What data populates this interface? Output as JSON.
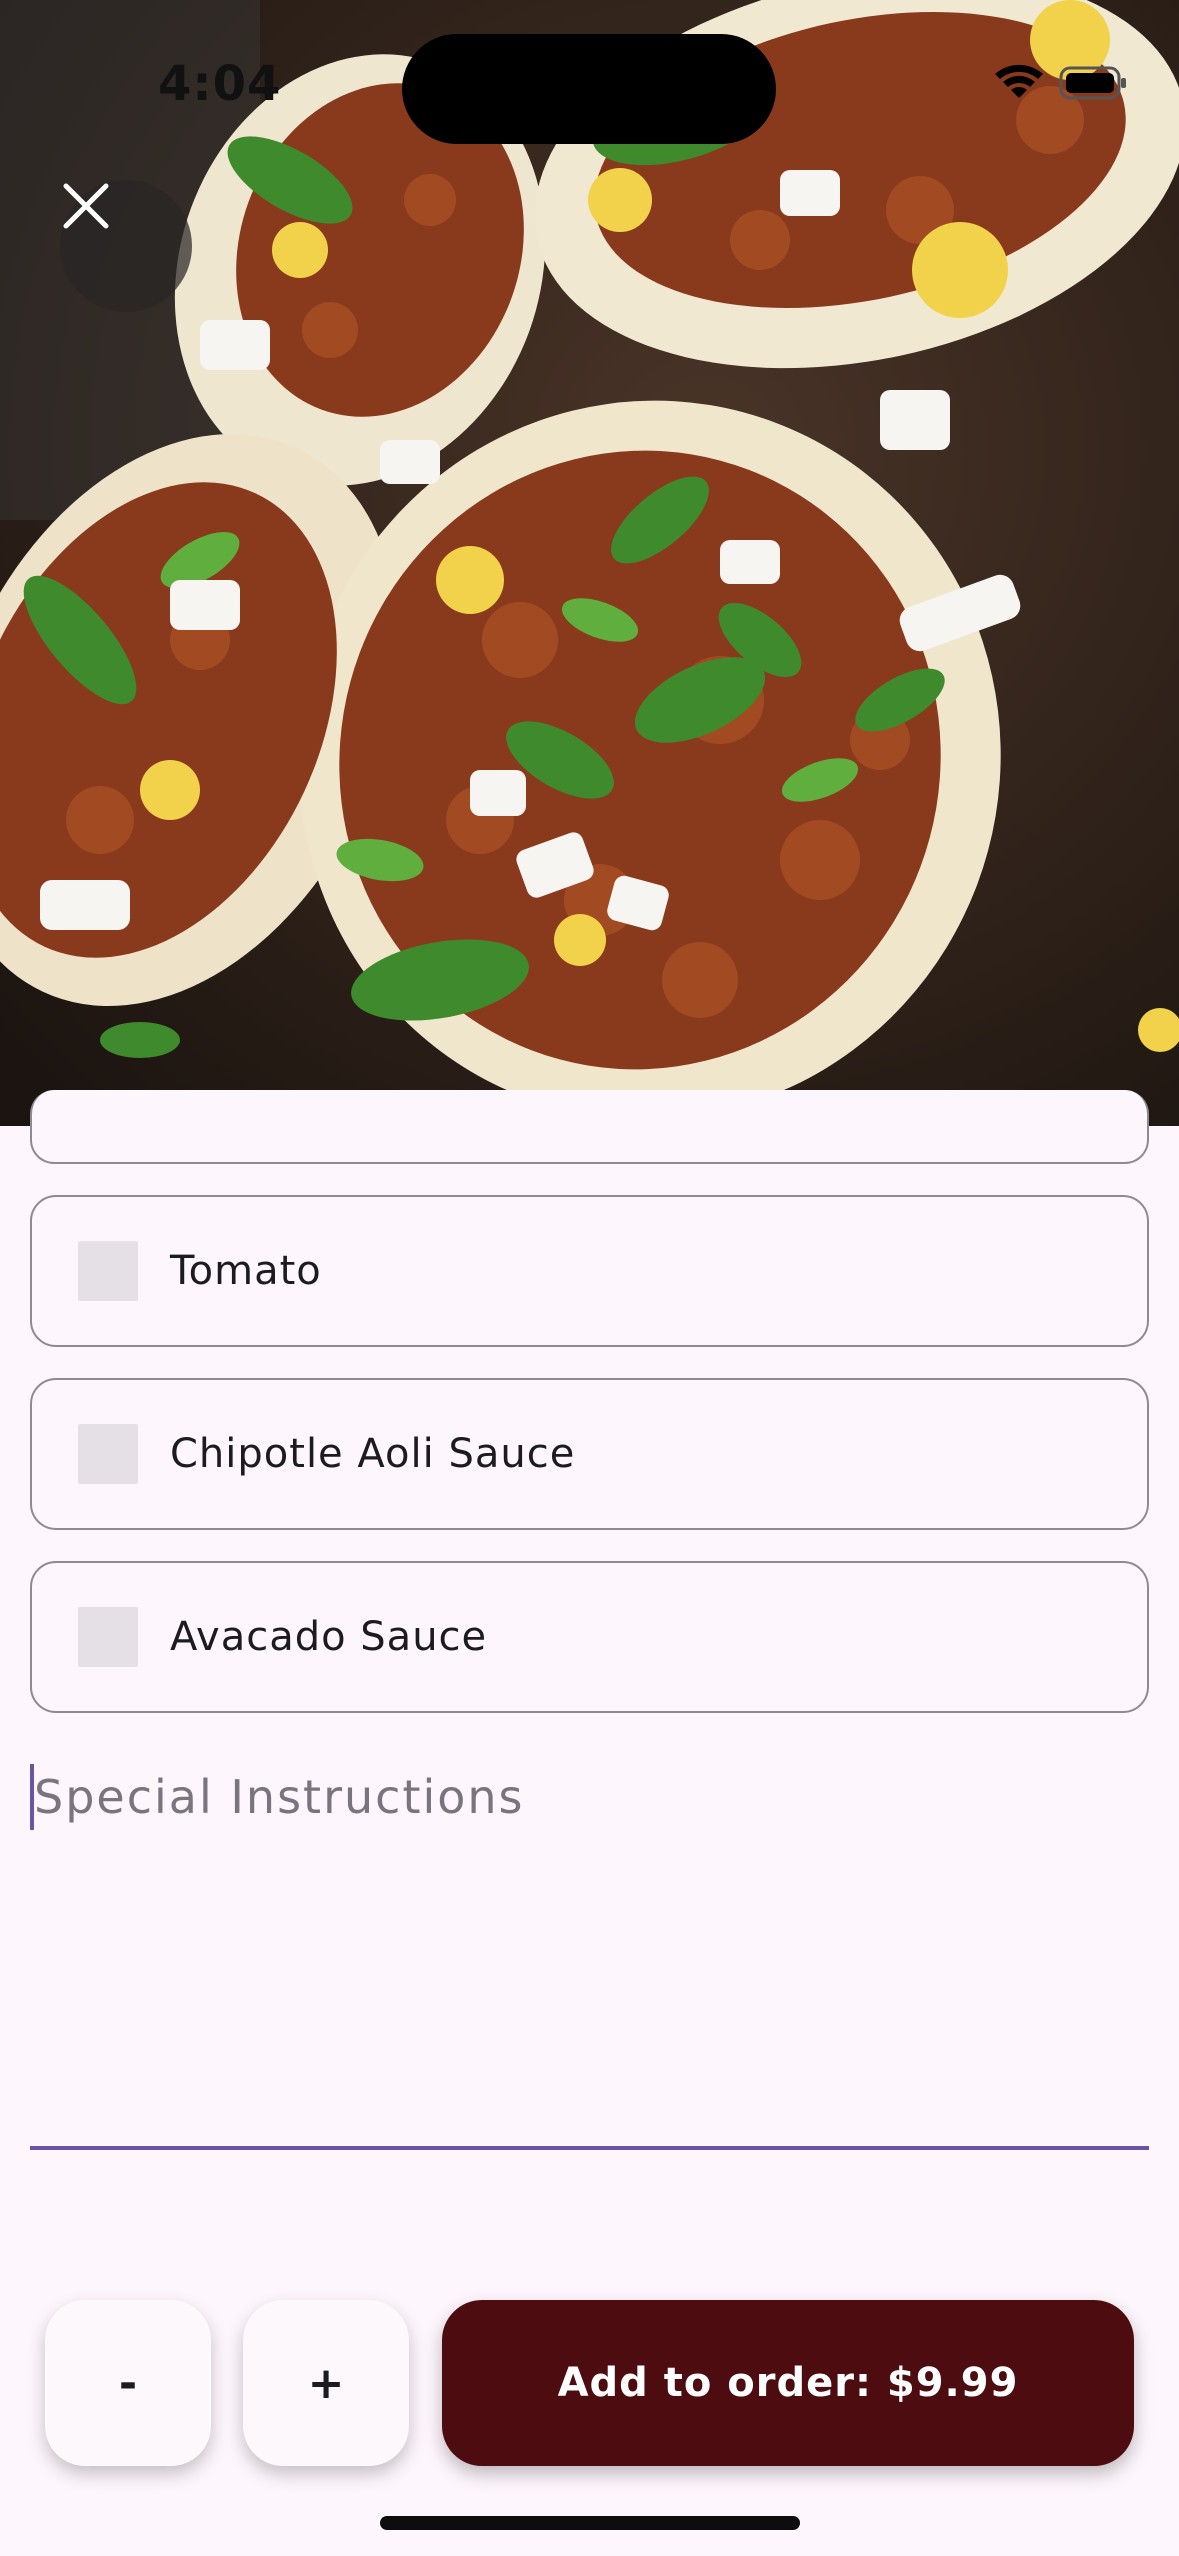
{
  "status_bar": {
    "time": "4:04",
    "icons": [
      "wifi-icon",
      "battery-icon"
    ]
  },
  "hero": {
    "image": "tacos-photo",
    "close_icon": "close-icon"
  },
  "options": [
    {
      "label": "Tomato",
      "checked": false
    },
    {
      "label": "Chipotle Aoli Sauce",
      "checked": false
    },
    {
      "label": "Avacado Sauce",
      "checked": false
    }
  ],
  "instructions": {
    "placeholder": "Special Instructions",
    "value": ""
  },
  "actions": {
    "decrement_label": "-",
    "increment_label": "+",
    "add_label": "Add to order: $9.99"
  },
  "colors": {
    "background": "#fdf6fc",
    "accent": "#6a54a8",
    "add_button": "#4d0d10",
    "border": "#8e8a90"
  }
}
